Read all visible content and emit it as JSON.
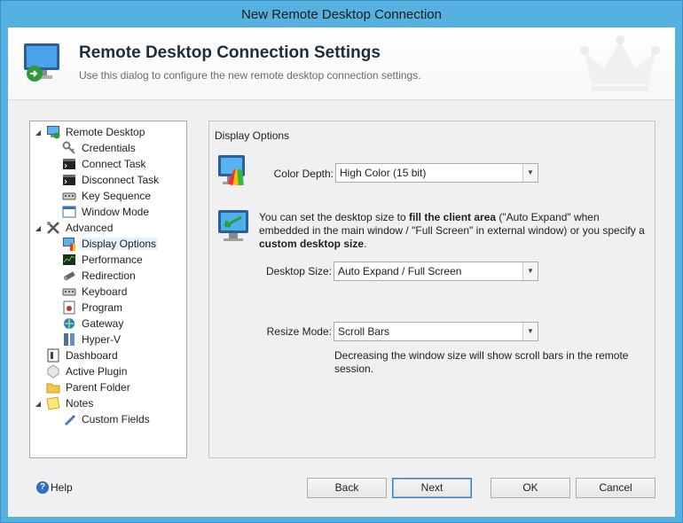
{
  "window": {
    "title": "New Remote Desktop Connection"
  },
  "header": {
    "title": "Remote Desktop Connection Settings",
    "subtitle": "Use this dialog to configure the new remote desktop connection settings."
  },
  "tree": {
    "items": [
      {
        "label": "Remote Desktop",
        "icon": "monitor-icon",
        "expander": "◢"
      },
      {
        "label": "Credentials",
        "icon": "key-icon"
      },
      {
        "label": "Connect Task",
        "icon": "console-icon"
      },
      {
        "label": "Disconnect Task",
        "icon": "console-icon"
      },
      {
        "label": "Key Sequence",
        "icon": "keyboard-icon"
      },
      {
        "label": "Window Mode",
        "icon": "window-icon"
      },
      {
        "label": "Advanced",
        "icon": "tools-icon",
        "expander": "◢"
      },
      {
        "label": "Display Options",
        "icon": "display-icon",
        "selected": true
      },
      {
        "label": "Performance",
        "icon": "performance-icon"
      },
      {
        "label": "Redirection",
        "icon": "redirection-icon"
      },
      {
        "label": "Keyboard",
        "icon": "keyboard-icon"
      },
      {
        "label": "Program",
        "icon": "program-icon"
      },
      {
        "label": "Gateway",
        "icon": "gateway-icon"
      },
      {
        "label": "Hyper-V",
        "icon": "hyperv-icon"
      },
      {
        "label": "Dashboard",
        "icon": "dashboard-icon"
      },
      {
        "label": "Active Plugin",
        "icon": "plugin-icon"
      },
      {
        "label": "Parent Folder",
        "icon": "folder-icon"
      },
      {
        "label": "Notes",
        "icon": "notes-icon",
        "expander": "◢"
      },
      {
        "label": "Custom Fields",
        "icon": "pen-icon"
      }
    ]
  },
  "panel": {
    "title": "Display Options",
    "color_depth": {
      "label": "Color Depth:",
      "value": "High Color (15 bit)"
    },
    "size_info": {
      "p1": "You can set the desktop size to ",
      "b1": "fill the client area",
      "p2": " (\"Auto Expand\" when embedded in the main window / \"Full Screen\" in external window) or you specify a ",
      "b2": "custom desktop size",
      "p3": "."
    },
    "desktop_size": {
      "label": "Desktop Size:",
      "value": "Auto Expand / Full Screen"
    },
    "resize_mode": {
      "label": "Resize Mode:",
      "value": "Scroll Bars"
    },
    "resize_info": "Decreasing the window size will show scroll bars in the remote session."
  },
  "footer": {
    "help": "Help",
    "back": "Back",
    "next": "Next",
    "ok": "OK",
    "cancel": "Cancel"
  },
  "colors": {
    "frame": "#54b1e0",
    "selection": "#e5f1fb",
    "default_button": "#3c7fb1"
  }
}
